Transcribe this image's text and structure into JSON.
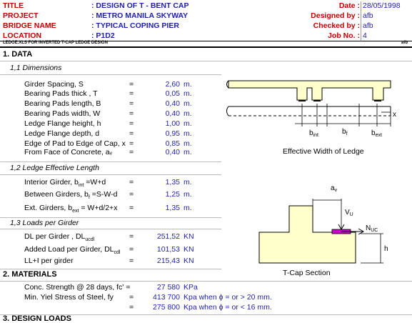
{
  "header": {
    "title_label": "TITLE",
    "title_value": ": DESIGN OF T - BENT CAP",
    "project_label": "PROJECT",
    "project_value": ": METRO MANILA SKYWAY",
    "bridge_label": "BRIDGE NAME",
    "bridge_value": ": TYPICAL COPING PIER",
    "location_label": "LOCATION",
    "location_value": ": P1D2",
    "date_label": "Date :",
    "date_value": "28/05/1998",
    "designed_label": "Designed by :",
    "designed_value": "afb",
    "checked_label": "Checked by :",
    "checked_value": "afb",
    "jobno_label": "Job No. :",
    "jobno_value": "4",
    "file_note": "LEDGE.XLS FOR INVERTED T-CAP LEDGE DESIGN",
    "file_note_right": "afb"
  },
  "section1": {
    "title": "1. DATA",
    "sub1": "1,1  Dimensions",
    "dims": [
      {
        "label": "Girder Spacing, S",
        "eq": "=",
        "value": "2,60",
        "unit": "m."
      },
      {
        "label": "Bearing Pads thick , T",
        "eq": "=",
        "value": "0,05",
        "unit": "m."
      },
      {
        "label": "Bearing Pads length, B",
        "eq": "=",
        "value": "0,40",
        "unit": "m."
      },
      {
        "label": "Bearing Pads width, W",
        "eq": "=",
        "value": "0,40",
        "unit": "m."
      },
      {
        "label": "Ledge Flange height, h",
        "eq": "=",
        "value": "1,00",
        "unit": "m."
      },
      {
        "label": "Ledge Flange depth, d",
        "eq": "=",
        "value": "0,95",
        "unit": "m."
      },
      {
        "label": "Edge of Pad to Edge of Cap, x",
        "eq": "=",
        "value": "0,85",
        "unit": "m."
      },
      {
        "label": "From Face of Concrete, aᵥ",
        "eq": "=",
        "value": "0,40",
        "unit": "m."
      }
    ],
    "diagram1_caption": "Effective Width of Ledge",
    "diagram1_labels": {
      "bint": "b",
      "bint_sub": "int",
      "bf": "b",
      "bf_sub": "f",
      "bext": "b",
      "bext_sub": "ext",
      "x": "x"
    },
    "sub2": "1,2  Ledge Effective Length",
    "lengths": [
      {
        "label": "Interior Girder, b",
        "label_sub": "int",
        "label_rest": " =W+d",
        "eq": "=",
        "value": "1,35",
        "unit": "m."
      },
      {
        "label": "Between Girders, b",
        "label_sub": "f",
        "label_rest": " =S-W-d",
        "eq": "=",
        "value": "1,25",
        "unit": "m."
      },
      {
        "label": "Ext. Girders, b",
        "label_sub": "ext",
        "label_rest": " = W+d/2+x",
        "eq": "=",
        "value": "1,35",
        "unit": "m."
      }
    ],
    "sub3": "1,3  Loads per Girder",
    "loads": [
      {
        "label": "DL per Girder , DL",
        "label_sub": "ucdl",
        "eq": "=",
        "value": "251,52",
        "unit": "KN"
      },
      {
        "label": "Added Load per Girder, DL",
        "label_sub": "cdl",
        "eq": "=",
        "value": "101,53",
        "unit": "KN"
      },
      {
        "label": "LL+I per girder",
        "label_sub": "",
        "eq": "=",
        "value": "215,43",
        "unit": "KN"
      }
    ],
    "diagram2_caption": "T-Cap Section",
    "diagram2_labels": {
      "av": "a",
      "av_sub": "v",
      "vu": "V",
      "vu_sub": "U",
      "nuc": "N",
      "nuc_sub": "UC",
      "h": "h"
    }
  },
  "section2": {
    "title": "2. MATERIALS",
    "rows": [
      {
        "label": "Conc. Strength @ 28 days, fc' =",
        "value": "27 580",
        "unit": "KPa"
      },
      {
        "label": "Min. Yiel Stress of Steel, fy",
        "eq": "=",
        "value": "413 700",
        "unit": "Kpa when ϕ = or > 20 mm."
      },
      {
        "label": "",
        "eq": "=",
        "value": "275 800",
        "unit": "Kpa when ϕ = or < 16 mm."
      }
    ]
  },
  "section3": {
    "title": "3. DESIGN LOADS"
  },
  "colors": {
    "header_red": "#c00000",
    "value_blue": "#1f1fa8",
    "tcap_fill": "#ffffcc",
    "pad_fill": "#cc00cc"
  }
}
